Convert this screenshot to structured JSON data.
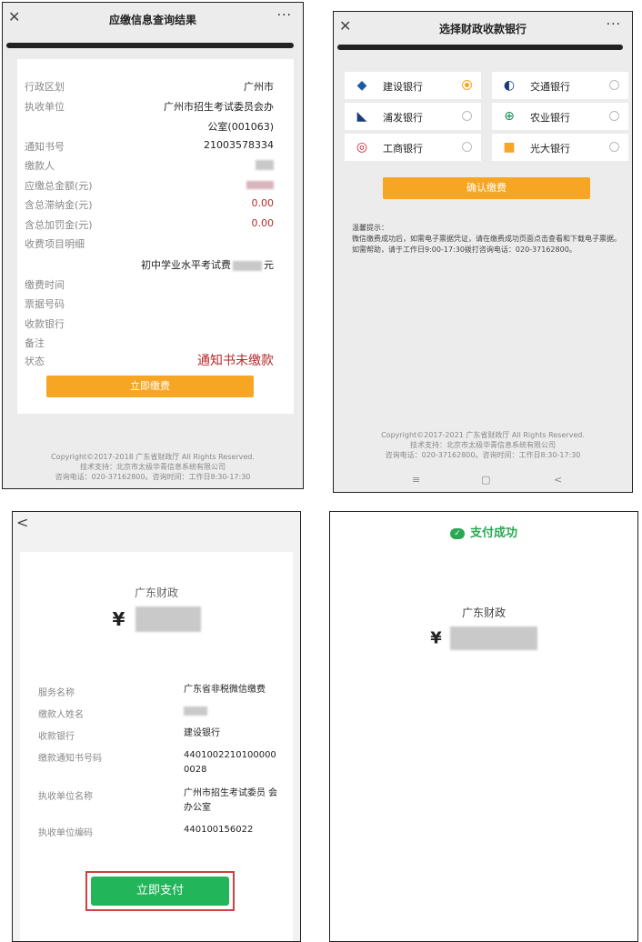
{
  "panel1": {
    "title": "应缴信息查询结果",
    "close_glyph": "✕",
    "more_glyph": "···",
    "rows": [
      {
        "label": "行政区划",
        "value": "广州市"
      },
      {
        "label": "执收单位",
        "value": "广州市招生考试委员会办"
      },
      {
        "label": "",
        "value": "公室(001063)"
      },
      {
        "label": "通知书号",
        "value": "21003578334"
      },
      {
        "label": "缴款人",
        "value": ""
      },
      {
        "label": "应缴总金额(元)",
        "value": ""
      },
      {
        "label": "含总滞纳金(元)",
        "value": "0.00"
      },
      {
        "label": "含总加罚金(元)",
        "value": "0.00"
      },
      {
        "label": "收费项目明细",
        "value": ""
      }
    ],
    "item_prefix": "初中学业水平考试费",
    "item_suffix": "元",
    "rows2": [
      {
        "label": "缴费时间"
      },
      {
        "label": "票据号码"
      },
      {
        "label": "收款银行"
      },
      {
        "label": "备注"
      }
    ],
    "status_label": "状态",
    "status_value": "通知书未缴款",
    "pay_button": "立即缴费",
    "footer": [
      "Copyright©2017-2018 广东省财政厅 All Rights Reserved.",
      "技术支持：北京市太极华青信息系统有限公司",
      "咨询电话：020-37162800。咨询时间：工作日8:30-17:30"
    ]
  },
  "panel2": {
    "title": "选择财政收款银行",
    "close_glyph": "✕",
    "more_glyph": "···",
    "banks": [
      {
        "name": "建设银行",
        "icon": "◆",
        "color": "#1a5aa6",
        "selected": true
      },
      {
        "name": "交通银行",
        "icon": "◐",
        "color": "#1b3c7a",
        "selected": false
      },
      {
        "name": "浦发银行",
        "icon": "◣",
        "color": "#1b3c7a",
        "selected": false
      },
      {
        "name": "农业银行",
        "icon": "⊕",
        "color": "#1b8a5a",
        "selected": false
      },
      {
        "name": "工商银行",
        "icon": "◎",
        "color": "#c8272d",
        "selected": false
      },
      {
        "name": "光大银行",
        "icon": "■",
        "color": "#f6a623",
        "selected": false
      }
    ],
    "confirm_button": "确认缴费",
    "tip_title": "温馨提示：",
    "tip_text": "微信缴费成功后，如需电子票据凭证，请在缴费成功页面点击查看和下载电子票据。如需帮助，请于工作日9:00-17:30拨打咨询电话：020-37162800。",
    "footer": [
      "Copyright©2017-2021 广东省财政厅 All Rights Reserved.",
      "技术支持：北京市太极华青信息系统有限公司",
      "咨询电话：020-37162800。咨询时间：工作日8:30-17:30"
    ],
    "nav": [
      "≡",
      "▢",
      "<"
    ]
  },
  "panel3": {
    "back_glyph": "<",
    "payee": "广东财政",
    "currency": "¥",
    "labels": [
      "服务名称",
      "缴款人姓名",
      "收款银行",
      "缴款通知书号码",
      "执收单位名称",
      "执收单位编码"
    ],
    "values": [
      "广东省非税微信缴费",
      "",
      "建设银行",
      "4401002210100000 0028",
      "广州市招生考试委员 会办公室",
      "440100156022"
    ],
    "pay_button": "立即支付"
  },
  "panel4": {
    "status": "支付成功",
    "payee": "广东财政",
    "currency": "¥"
  }
}
